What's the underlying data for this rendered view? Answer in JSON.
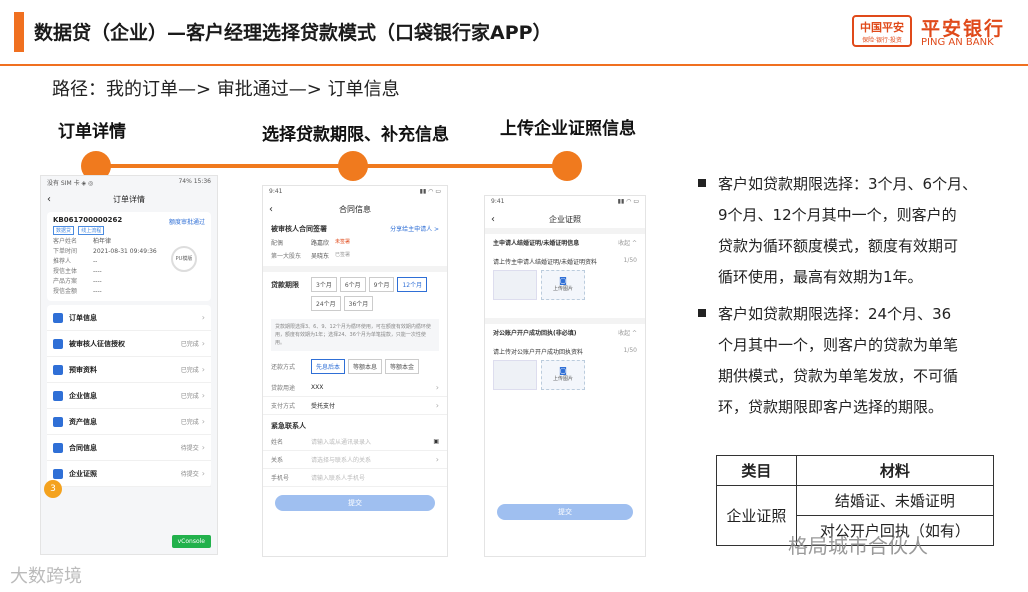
{
  "header": {
    "title": "数据贷（企业）—客户经理选择贷款模式（口袋银行家APP）",
    "logo_box_text": "中国平安",
    "logo_box_sub": "保险·银行·投资",
    "logo_cn": "平安银行",
    "logo_en": "PING AN BANK",
    "accent_color": "#f07020"
  },
  "path_text": "路径：我的订单—> 审批通过—> 订单信息",
  "steps": [
    {
      "label": "订单详情"
    },
    {
      "label": "选择贷款期限、补充信息"
    },
    {
      "label": "上传企业证照信息"
    }
  ],
  "phone1": {
    "status_left": "没有 SIM 卡 ◈ ◎",
    "status_right": "74% 15:36",
    "nav_title": "订单详情",
    "order_id": "KB061700000262",
    "amount_link": "额度审批通过",
    "tags": [
      "数据贷",
      "线上流程"
    ],
    "pu_badge": "PU模版",
    "rows": [
      {
        "k": "客户姓名",
        "v": "柏年律"
      },
      {
        "k": "下单时间",
        "v": "2021-08-31 09:49:36"
      },
      {
        "k": "推荐人",
        "v": "--"
      },
      {
        "k": "授信主体",
        "v": "----"
      },
      {
        "k": "产品方案",
        "v": "----"
      },
      {
        "k": "授信金额",
        "v": "----"
      }
    ],
    "menu": [
      {
        "label": "订单信息",
        "status": ""
      },
      {
        "label": "被审核人征信授权",
        "status": "已完成"
      },
      {
        "label": "预审资料",
        "status": "已完成"
      },
      {
        "label": "企业信息",
        "status": "已完成"
      },
      {
        "label": "资产信息",
        "status": "已完成"
      },
      {
        "label": "合同信息",
        "status": "待提交"
      },
      {
        "label": "企业证照",
        "status": "待提交"
      }
    ],
    "vconsole": "vConsole",
    "float_badge": "3"
  },
  "phone2": {
    "time": "9:41",
    "nav_title": "合同信息",
    "sec1_title": "被审核人合同签署",
    "sec1_link": "分享给主申请人 >",
    "signers": [
      {
        "k": "配偶",
        "v": "路嘉欣",
        "tag": "未签署"
      },
      {
        "k": "第一大股东",
        "v": "吴晓东",
        "tag": "已签署"
      }
    ],
    "term_label": "贷款期限",
    "terms": [
      "3个月",
      "6个月",
      "9个月",
      "12个月",
      "24个月",
      "36个月"
    ],
    "active_term": "12个月",
    "note": "贷款期限选择3、6、9、12个月为循环使用，可在额度有效期内循环使用，额度有效期为1年；选择24、36个月为单笔提款，只能一次性使用。",
    "repay_label": "还款方式",
    "repay_options": [
      "先息后本",
      "等额本息",
      "等额本金"
    ],
    "use_label": "贷款用途",
    "use_value": "XXX",
    "pay_label": "支付方式",
    "pay_value": "受托支付",
    "contact_title": "紧急联系人",
    "contact_fields": [
      {
        "k": "姓名",
        "ph": "请输入或从通讯录录入"
      },
      {
        "k": "关系",
        "ph": "请选择与联系人的关系"
      },
      {
        "k": "手机号",
        "ph": "请输入联系人手机号"
      }
    ],
    "submit": "提交"
  },
  "phone3": {
    "time": "9:41",
    "nav_title": "企业证照",
    "sections": [
      {
        "head": "主申请人结婚证明/未婚证明信息",
        "fold": "收起 ^",
        "desc": "请上传主申请人结婚证明/未婚证明资料",
        "count": "1/50",
        "add": "上传图片"
      },
      {
        "head": "对公账户开户成功回执(非必填)",
        "fold": "收起 ^",
        "desc": "请上传对公账户开户成功回执资料",
        "count": "1/50",
        "add": "上传图片"
      }
    ],
    "submit": "提交"
  },
  "bullets": [
    {
      "lines": [
        "客户如贷款期限选择：3个月、6个月、",
        "9个月、12个月其中一个，则客户的",
        "贷款为循环额度模式，额度有效期可",
        "循环使用，最高有效期为1年。"
      ]
    },
    {
      "lines": [
        "客户如贷款期限选择：24个月、36",
        "个月其中一个，则客户的贷款为单笔",
        "期供模式，贷款为单笔发放，不可循",
        "环，贷款期限即客户选择的期限。"
      ]
    }
  ],
  "table": {
    "headers": [
      "类目",
      "材料"
    ],
    "category": "企业证照",
    "materials": [
      "结婚证、未婚证明",
      "对公开户回执（如有）"
    ]
  },
  "watermark_left": "大数跨境",
  "watermark_right": "格局城市合伙人"
}
